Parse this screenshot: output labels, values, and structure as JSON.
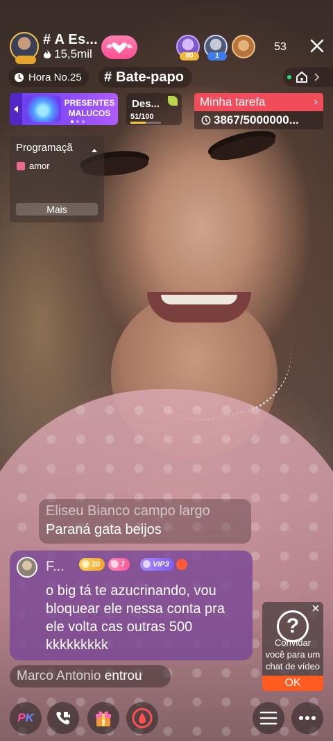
{
  "host": {
    "name": "# A Es...",
    "fans": "15,5mil"
  },
  "viewers": {
    "badges": [
      "80",
      "1"
    ],
    "count": "53"
  },
  "info_bar": {
    "hour": "Hora No.25",
    "topic_hash": "#",
    "topic": "Bate-papo"
  },
  "promo_banner": {
    "line1": "PRESENTES",
    "line2": "MALUCOS"
  },
  "challenge": {
    "title": "Des...",
    "progress": "51/100",
    "progress_fraction": 0.51
  },
  "task": {
    "title": "Minha tarefa",
    "progress": "3867/5000000..."
  },
  "program": {
    "title": "Programaçã",
    "item": "amor",
    "more_label": "Mais"
  },
  "chat": {
    "message1_line1": "Eliseu Bianco campo largo",
    "message1_line2": "Paraná gata beijos",
    "message2_name": "F...",
    "message2_level": "20",
    "message2_fan_level": "7",
    "message2_vip": "VIP3",
    "message2_text": "o big tá te azucrinando, vou bloquear ele nessa conta pra ele volta cas outras 500 kkkkkkkkk",
    "join_name": "Marco Antonio",
    "join_text": "entrou"
  },
  "invite": {
    "text": "Convidar você para um chat de vídeo",
    "ok_label": "OK"
  },
  "bottom_bar": {
    "pk_p": "P",
    "pk_k": "K"
  },
  "colors": {
    "follow_pink": "#ff5a99",
    "task_red": "#f04c5a",
    "promo_purple": "#8f4ef8",
    "chat_purple": "#7a4896",
    "ok_orange": "#ff5a1f",
    "online_green": "#27e07a"
  },
  "icons": [
    "flame-icon",
    "heart-wings-icon",
    "close-icon",
    "clock-icon",
    "home-icon",
    "chevron-right-icon",
    "leaf-icon",
    "clock-outline-icon",
    "gift-small-icon",
    "help-icon",
    "video-call-icon",
    "gift-icon",
    "drop-icon",
    "menu-icon",
    "more-icon"
  ]
}
